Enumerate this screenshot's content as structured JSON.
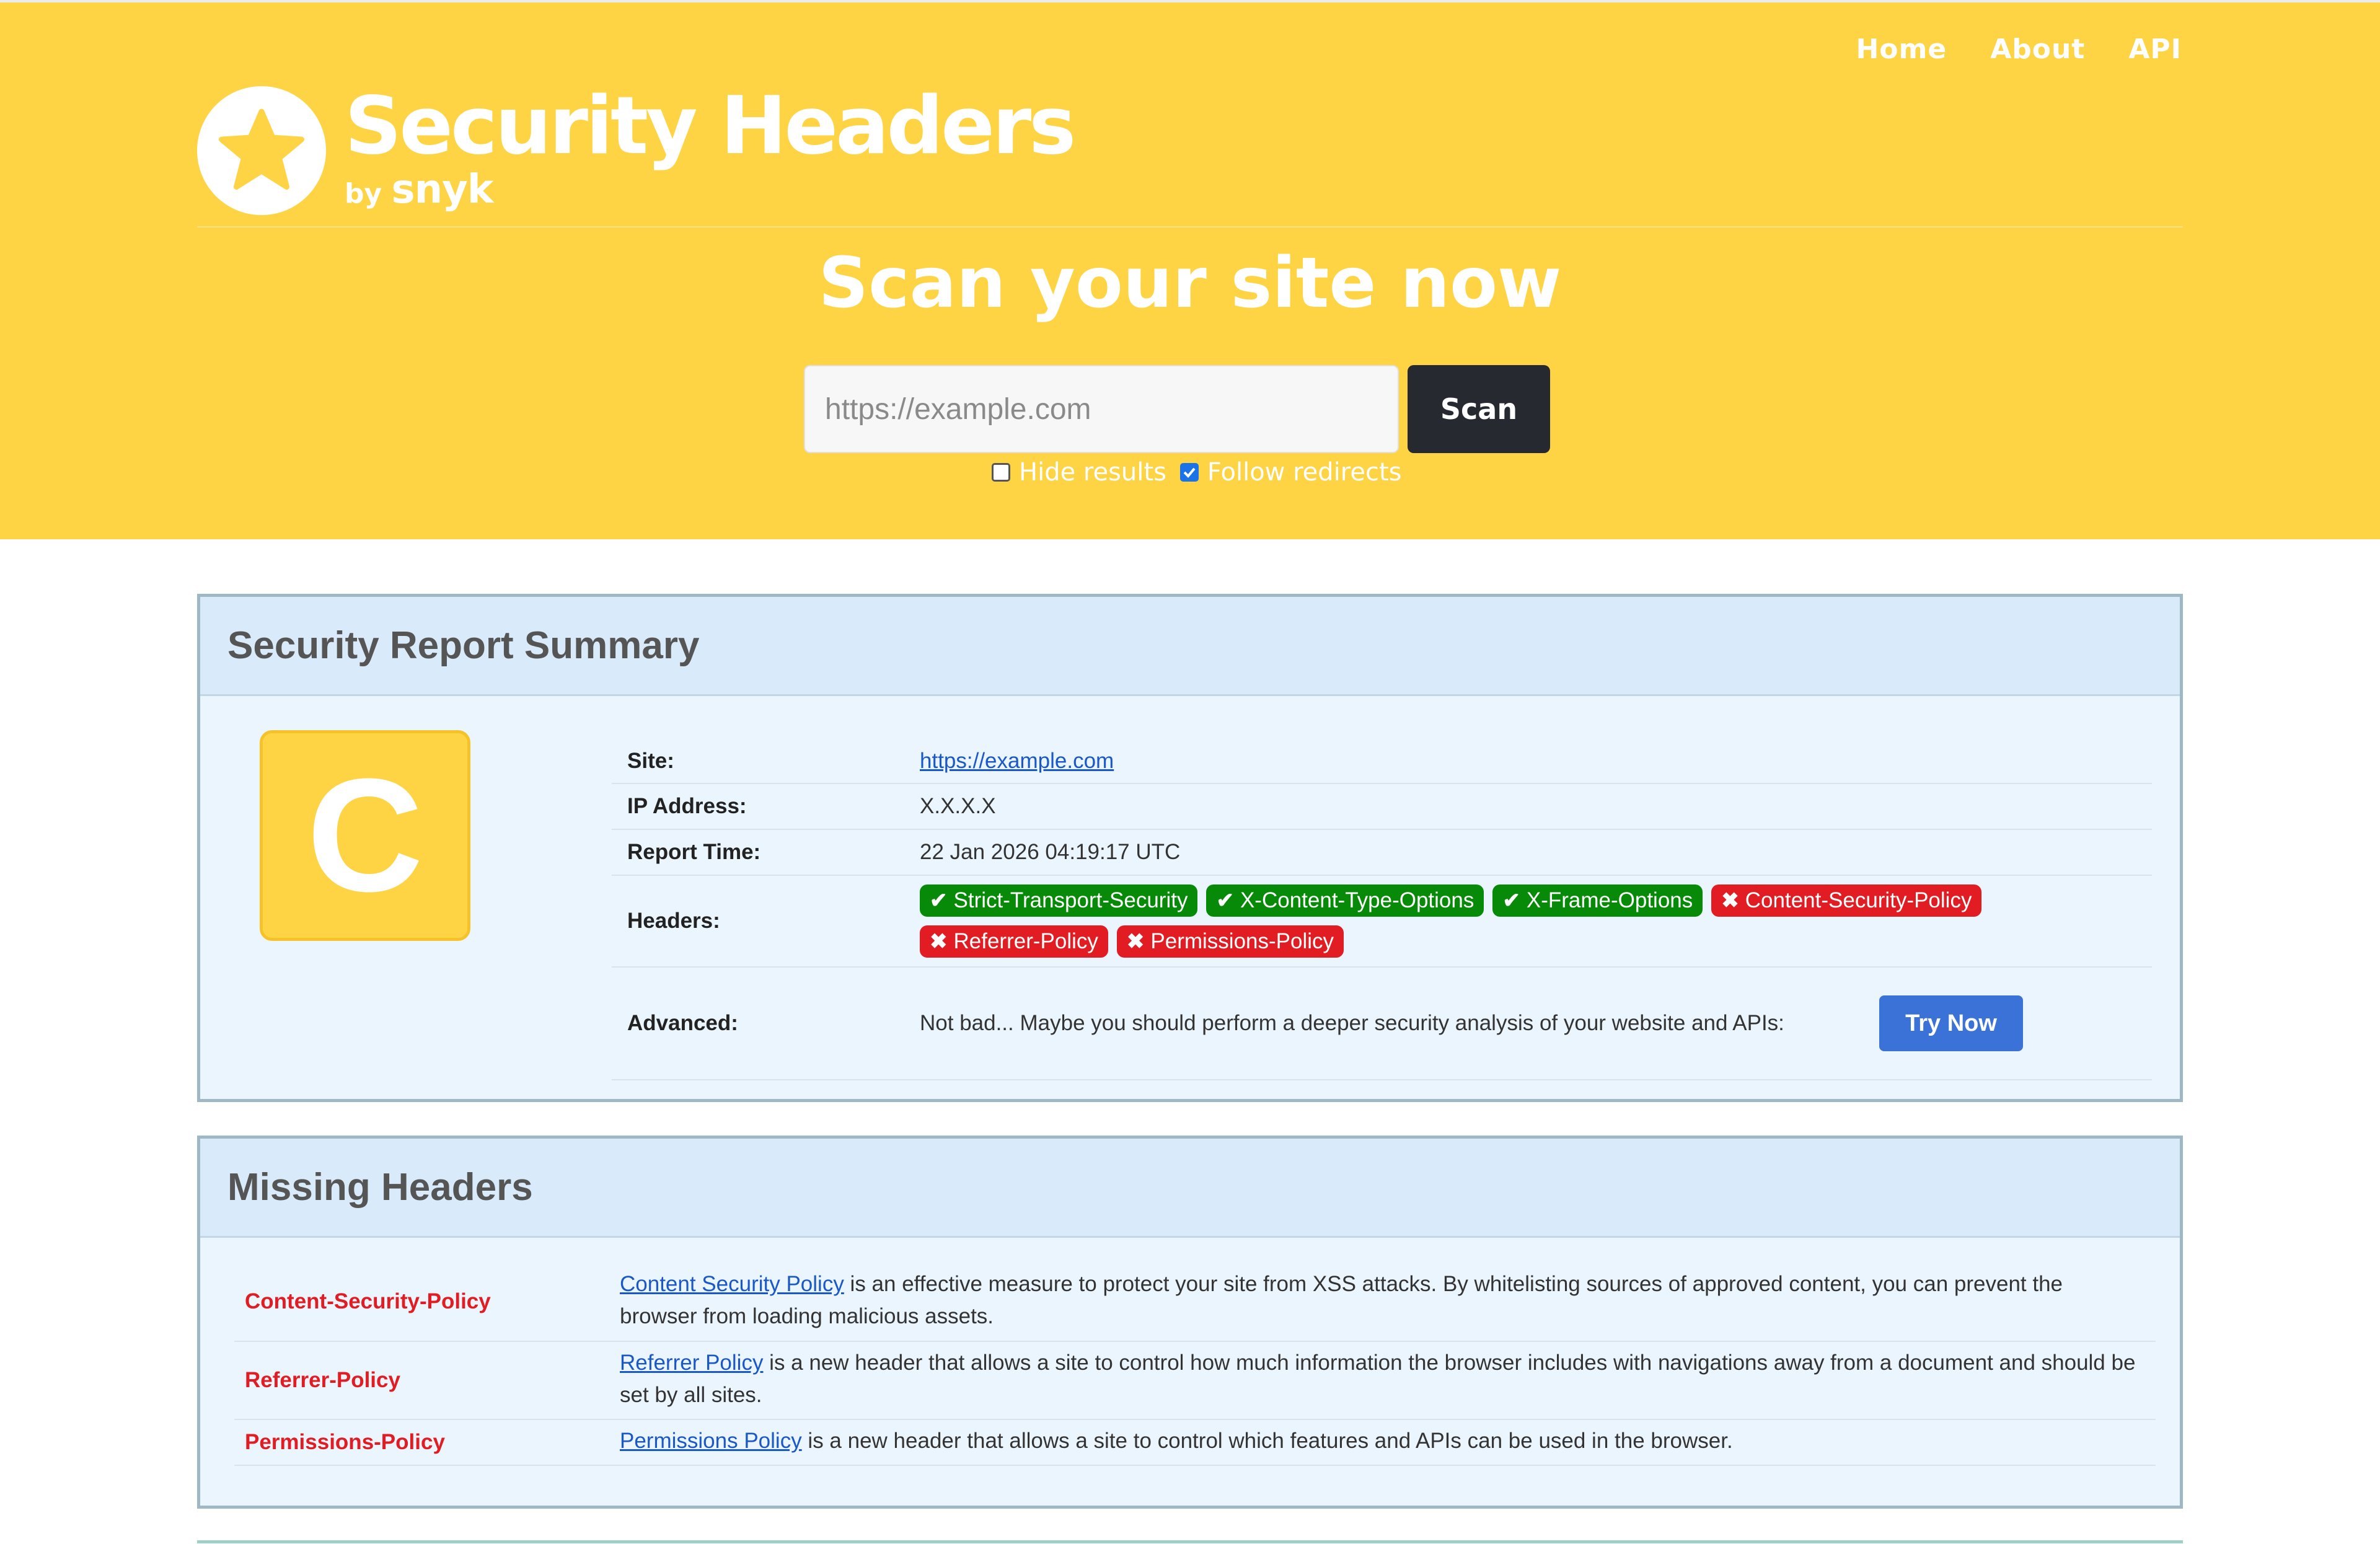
{
  "nav": {
    "home": "Home",
    "about": "About",
    "api": "API"
  },
  "logo": {
    "title": "Security Headers",
    "by": "by",
    "brand": "snyk"
  },
  "hero": {
    "title": "Scan your site now",
    "input_placeholder": "https://example.com",
    "scan_label": "Scan",
    "hide_results_label": "Hide results",
    "hide_results_checked": false,
    "follow_redirects_label": "Follow redirects",
    "follow_redirects_checked": true
  },
  "summary": {
    "title": "Security Report Summary",
    "grade": "C",
    "site_label": "Site:",
    "site_value": "https://example.com",
    "ip_label": "IP Address:",
    "ip_value": "X.X.X.X",
    "time_label": "Report Time:",
    "time_value": "22 Jan 2026 04:19:17 UTC",
    "headers_label": "Headers:",
    "headers": [
      {
        "name": "Strict-Transport-Security",
        "status": "present"
      },
      {
        "name": "X-Content-Type-Options",
        "status": "present"
      },
      {
        "name": "X-Frame-Options",
        "status": "present"
      },
      {
        "name": "Content-Security-Policy",
        "status": "missing"
      },
      {
        "name": "Referrer-Policy",
        "status": "missing"
      },
      {
        "name": "Permissions-Policy",
        "status": "missing"
      }
    ],
    "advanced_label": "Advanced:",
    "advanced_text": "Not bad... Maybe you should perform a deeper security analysis of your website and APIs:",
    "try_now_label": "Try Now"
  },
  "missing": {
    "title": "Missing Headers",
    "rows": [
      {
        "header": "Content-Security-Policy",
        "link": "Content Security Policy",
        "text": " is an effective measure to protect your site from XSS attacks. By whitelisting sources of approved content, you can prevent the browser from loading malicious assets."
      },
      {
        "header": "Referrer-Policy",
        "link": "Referrer Policy",
        "text": " is a new header that allows a site to control how much information the browser includes with navigations away from a document and should be set by all sites."
      },
      {
        "header": "Permissions-Policy",
        "link": "Permissions Policy",
        "text": " is a new header that allows a site to control which features and APIs can be used in the browser."
      }
    ]
  },
  "colors": {
    "brand_yellow": "#ffd444",
    "present_green": "#078a07",
    "missing_red": "#e11d23",
    "try_blue": "#3a72d8"
  }
}
